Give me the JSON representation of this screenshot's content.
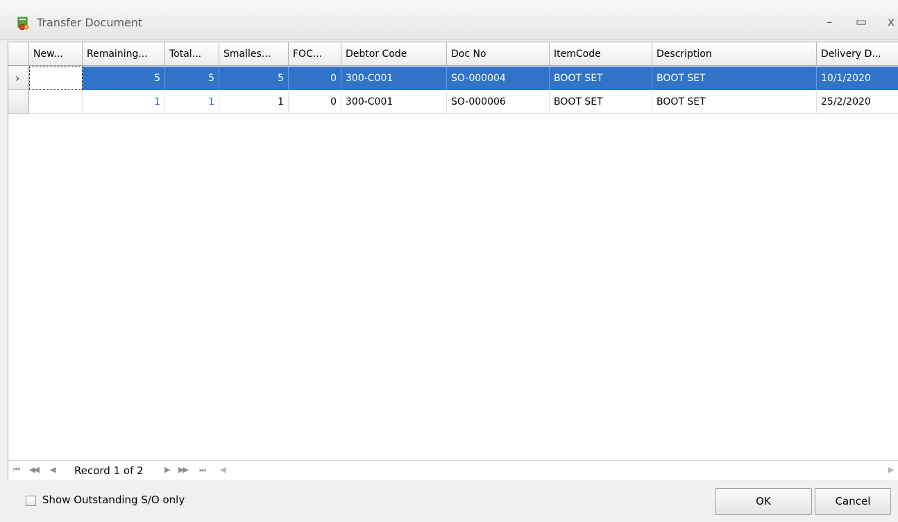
{
  "window": {
    "title": "Transfer Document",
    "minimize": "–",
    "maximize": "▭",
    "close": "x"
  },
  "grid": {
    "columns": [
      "New...",
      "Remaining...",
      "Total...",
      "Smalles...",
      "FOC...",
      "Debtor Code",
      "Doc No",
      "ItemCode",
      "Description",
      "Delivery D..."
    ],
    "rows": [
      {
        "new": "",
        "remaining": "5",
        "total": "5",
        "smallest": "5",
        "foc": "0",
        "debtor_code": "300-C001",
        "doc_no": "SO-000004",
        "item_code": "BOOT SET",
        "description": "BOOT SET",
        "delivery_date": "10/1/2020",
        "selected": true
      },
      {
        "new": "",
        "remaining": "1",
        "total": "1",
        "smallest": "1",
        "foc": "0",
        "debtor_code": "300-C001",
        "doc_no": "SO-000006",
        "item_code": "BOOT SET",
        "description": "BOOT SET",
        "delivery_date": "25/2/2020",
        "selected": false
      }
    ],
    "row_indicator": "›"
  },
  "navigator": {
    "first": "⏮",
    "prev_page": "◀◀",
    "prev": "◀",
    "record_text": "Record 1 of 2",
    "next": "▶",
    "next_page": "▶▶",
    "last": "⏭",
    "scroll_left": "◀",
    "scroll_right": "▶"
  },
  "footer": {
    "checkbox_label": "Show Outstanding S/O only",
    "checkbox_checked": false,
    "ok_label": "OK",
    "cancel_label": "Cancel"
  },
  "colors": {
    "selection": "#3073c9",
    "blue_text": "#3b5fcf"
  }
}
